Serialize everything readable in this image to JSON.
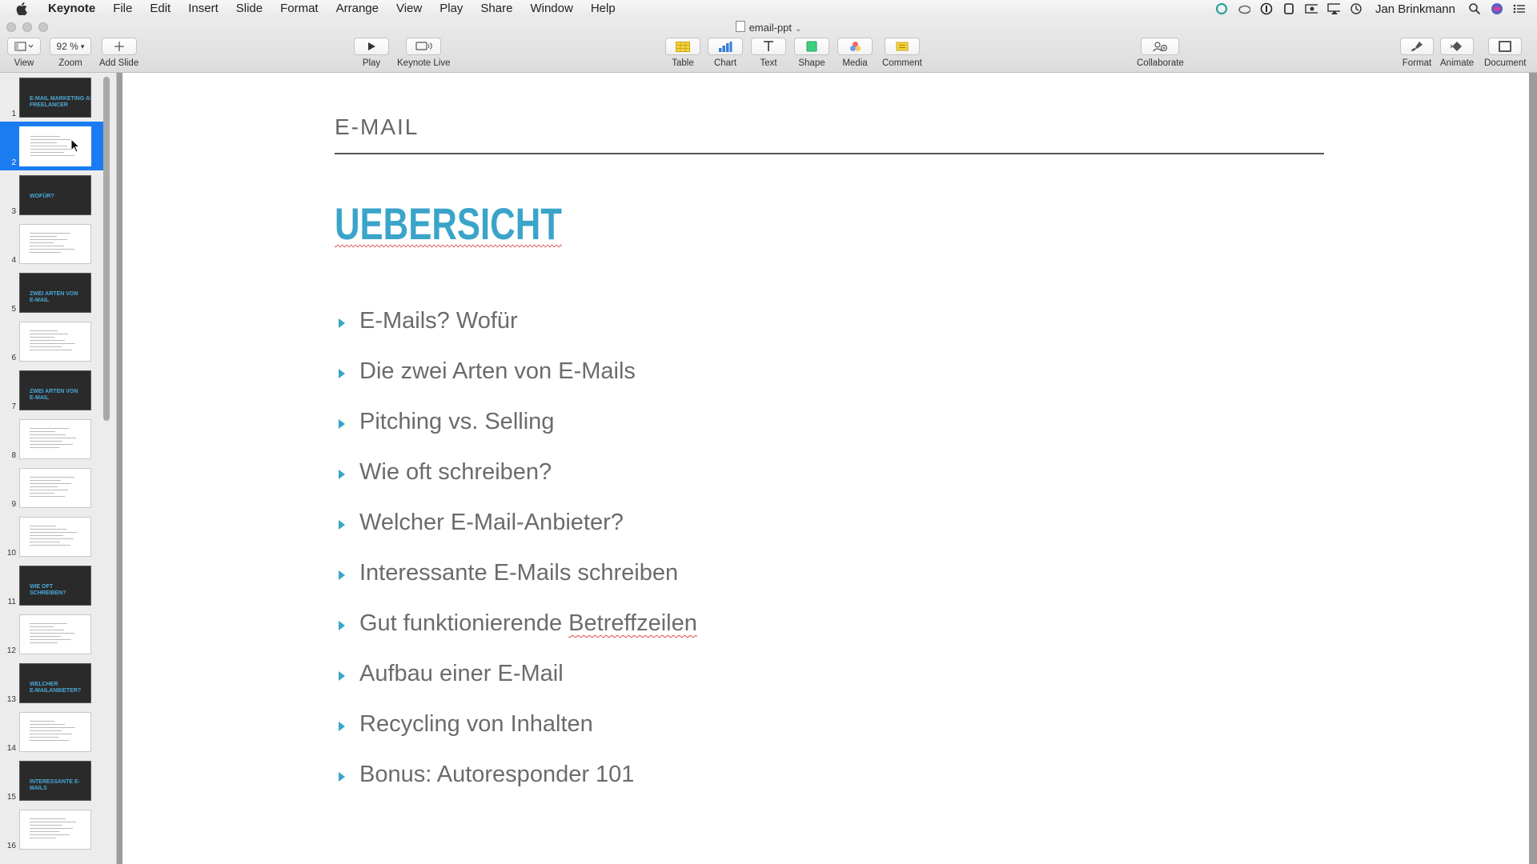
{
  "menubar": {
    "items": [
      "Keynote",
      "File",
      "Edit",
      "Insert",
      "Slide",
      "Format",
      "Arrange",
      "View",
      "Play",
      "Share",
      "Window",
      "Help"
    ],
    "user": "Jan Brinkmann"
  },
  "window": {
    "title": "email-ppt"
  },
  "toolbar": {
    "view": "View",
    "zoom_value": "92 %",
    "zoom": "Zoom",
    "add_slide": "Add Slide",
    "play": "Play",
    "keynote_live": "Keynote Live",
    "table": "Table",
    "chart": "Chart",
    "text": "Text",
    "shape": "Shape",
    "media": "Media",
    "comment": "Comment",
    "collaborate": "Collaborate",
    "format": "Format",
    "animate": "Animate",
    "document": "Document"
  },
  "sidebar": {
    "slides": [
      {
        "num": "1",
        "style": "dark",
        "text": "E-MAIL MARKETING ALS\nFREELANCER"
      },
      {
        "num": "2",
        "style": "light",
        "text": "",
        "selected": true
      },
      {
        "num": "3",
        "style": "dark",
        "text": "WOFÜR?"
      },
      {
        "num": "4",
        "style": "light",
        "text": ""
      },
      {
        "num": "5",
        "style": "dark",
        "text": "ZWEI ARTEN VON\nE-MAIL"
      },
      {
        "num": "6",
        "style": "light",
        "text": ""
      },
      {
        "num": "7",
        "style": "dark",
        "text": "ZWEI ARTEN VON\nE-MAIL"
      },
      {
        "num": "8",
        "style": "light",
        "text": ""
      },
      {
        "num": "9",
        "style": "light",
        "text": ""
      },
      {
        "num": "10",
        "style": "light",
        "text": ""
      },
      {
        "num": "11",
        "style": "dark",
        "text": "WIE OFT\nSCHREIBEN?"
      },
      {
        "num": "12",
        "style": "light",
        "text": ""
      },
      {
        "num": "13",
        "style": "dark",
        "text": "WELCHER\nE-MAILANBIETER?"
      },
      {
        "num": "14",
        "style": "light",
        "text": ""
      },
      {
        "num": "15",
        "style": "dark",
        "text": "INTERESSANTE E-\nMAILS"
      },
      {
        "num": "16",
        "style": "light",
        "text": ""
      }
    ]
  },
  "slide": {
    "header": "E-MAIL",
    "title": "UEBERSICHT",
    "bullets": [
      "E-Mails? Wofür",
      "Die zwei Arten von E-Mails",
      "Pitching vs. Selling",
      "Wie oft schreiben?",
      "Welcher E-Mail-Anbieter?",
      "Interessante E-Mails schreiben",
      "Gut funktionierende Betreffzeilen",
      "Aufbau einer E-Mail",
      "Recycling von Inhalten",
      "Bonus: Autoresponder 101"
    ]
  },
  "colors": {
    "accent": "#3aa4c9",
    "selection": "#1b7cf2"
  }
}
